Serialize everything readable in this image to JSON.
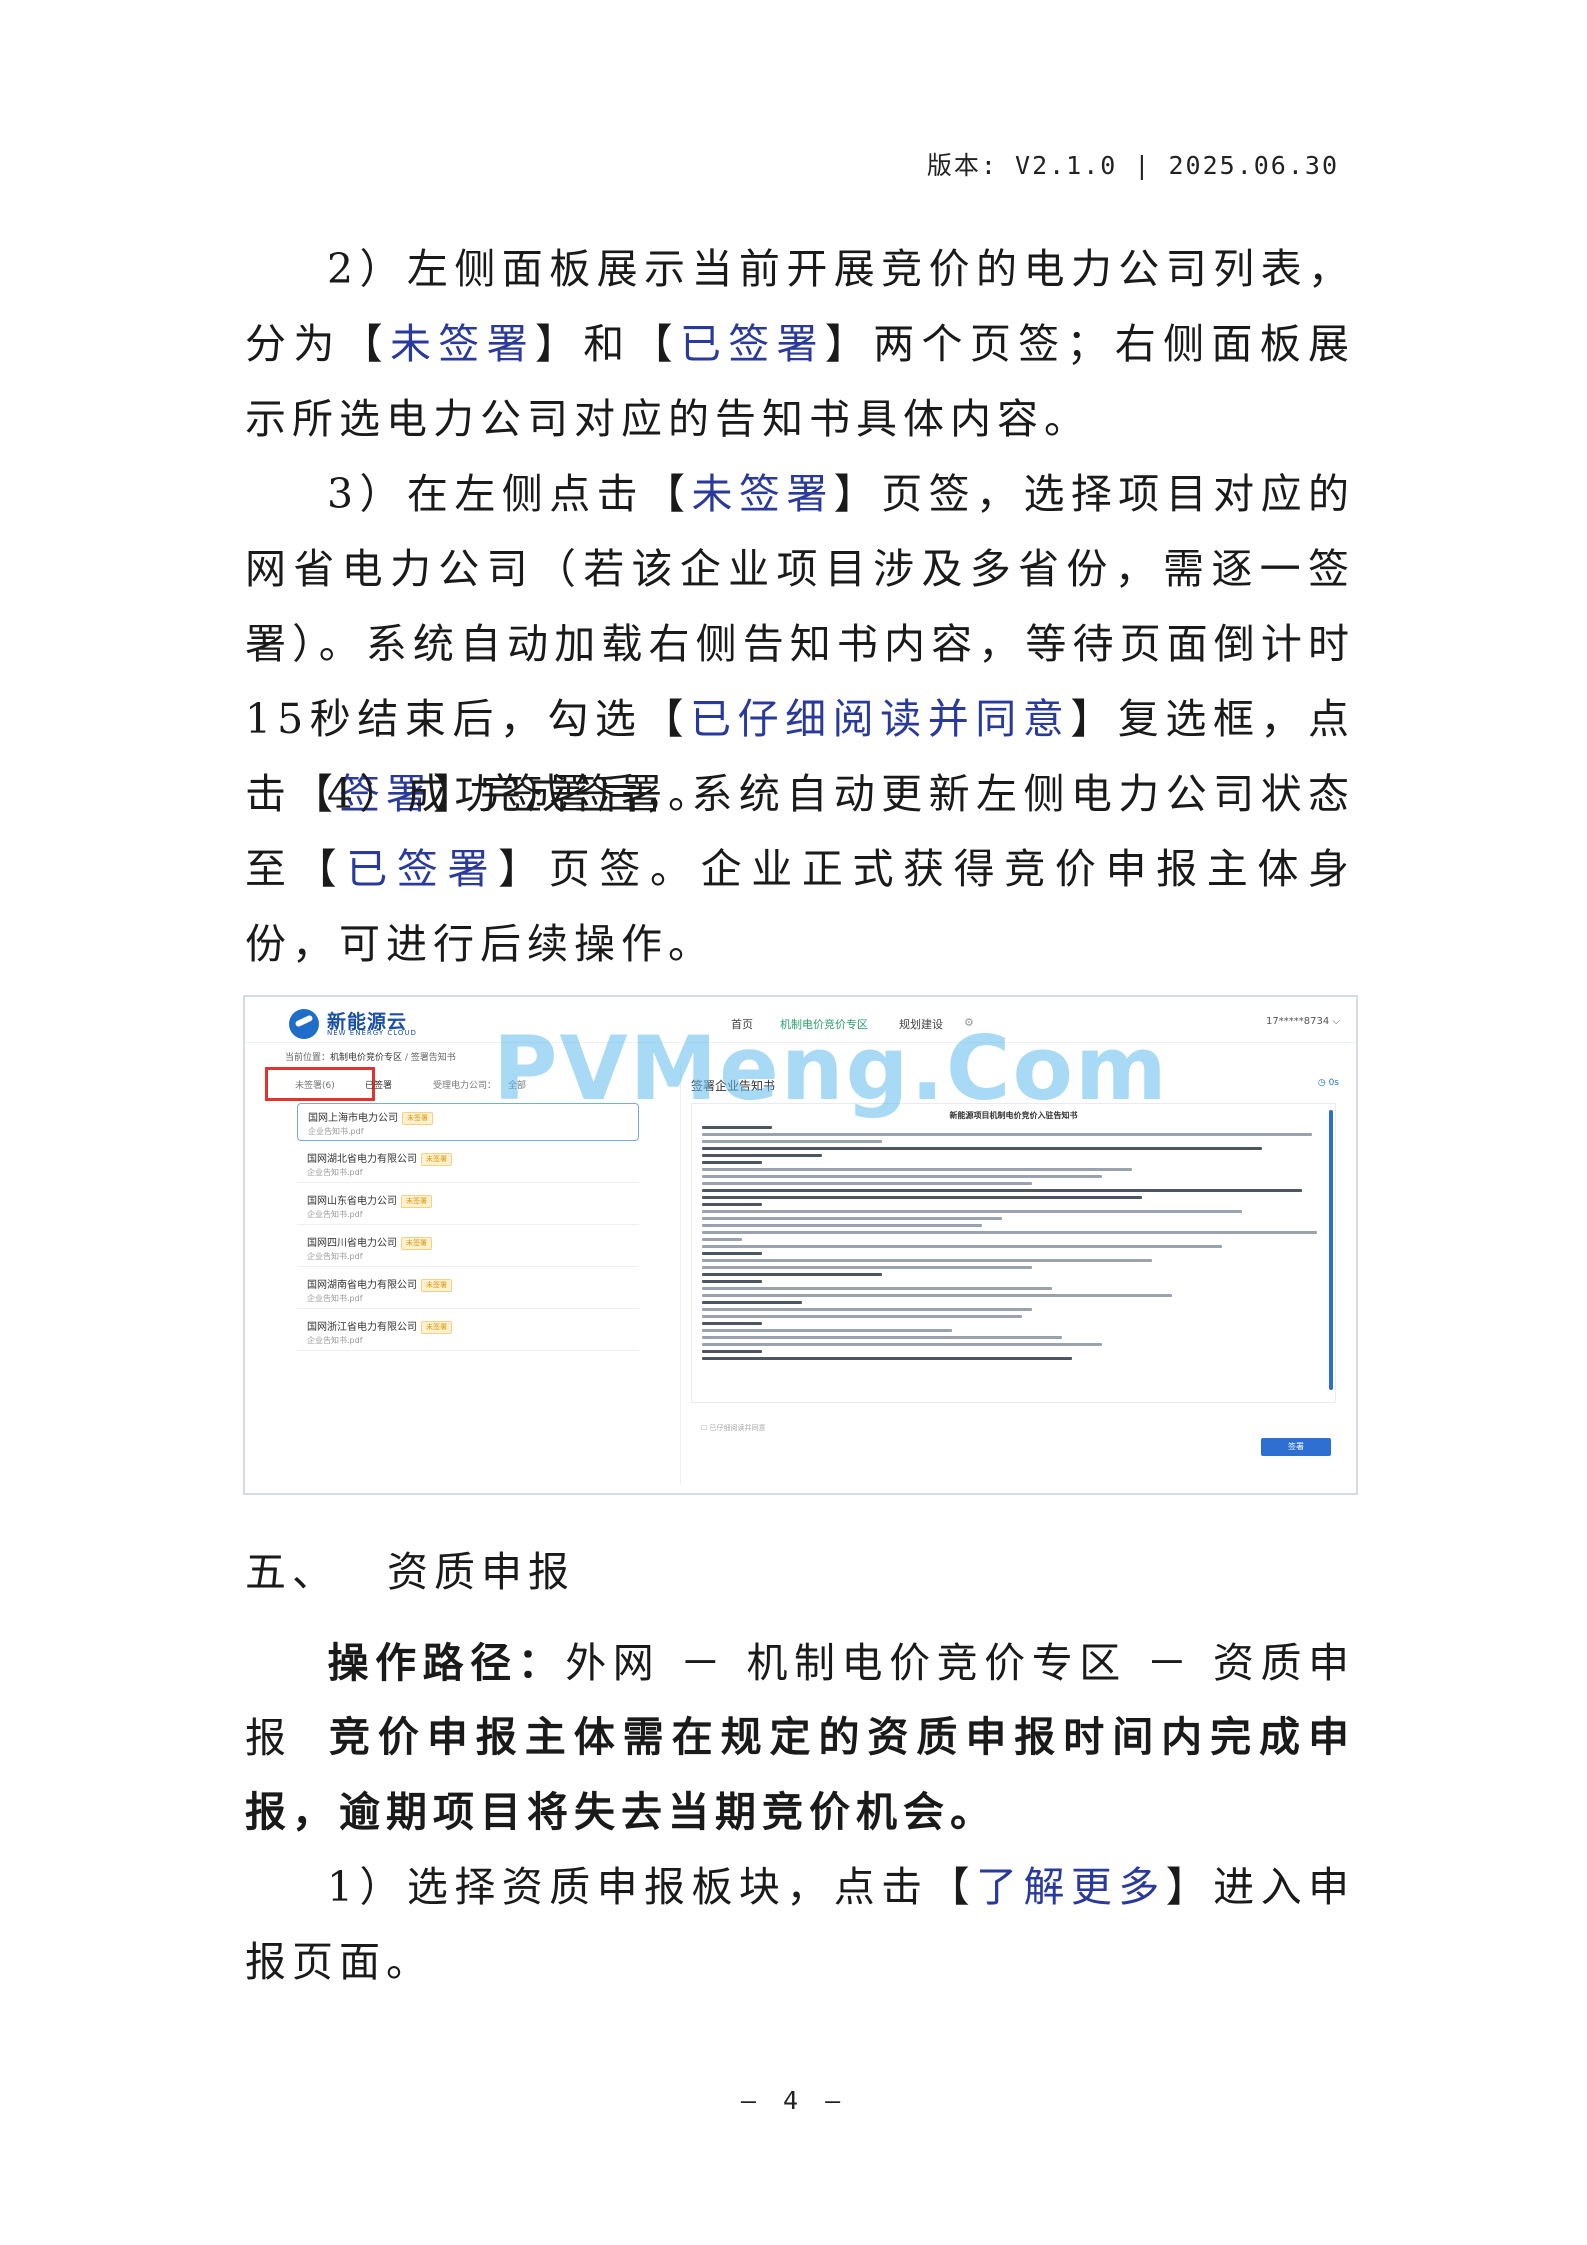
{
  "header": {
    "version": "版本: V2.1.0 | 2025.06.30"
  },
  "para2": {
    "lead": "2）左侧面板展示当前开展竞价的电力公司列表，分为【",
    "tab_unsigned": "未签署",
    "mid": "】和【",
    "tab_signed": "已签署",
    "tail": "】两个页签；右侧面板展示所选电力公司对应的告知书具体内容。"
  },
  "para3": {
    "lead": "3）在左侧点击【",
    "tab_unsigned": "未签署",
    "mid1": "】页签，选择项目对应的网省电力公司（若该企业项目涉及多省份，需逐一签署）。系统自动加载右侧告知书内容，等待页面倒计时15秒结束后，勾选【",
    "checkbox": "已仔细阅读并同意",
    "mid2": "】复选框，点击【",
    "button": "签署",
    "tail": "】完成签署。"
  },
  "para4": {
    "lead": "4）成功签署后，系统自动更新左侧电力公司状态至【",
    "tab_signed": "已签署",
    "tail": "】页签。企业正式获得竞价申报主体身份，可进行后续操作。"
  },
  "screenshot": {
    "logo_title": "新能源云",
    "logo_sub": "NEW ENERGY CLOUD",
    "nav": [
      "首页",
      "机制电价竞价专区",
      "规划建设"
    ],
    "user": "17*****8734",
    "breadcrumb_prefix": "当前位置：",
    "breadcrumb_1": "机制电价竞价专区",
    "breadcrumb_sep": " / ",
    "breadcrumb_2": "签署告知书",
    "tab_unsigned": "未签署(6)",
    "tab_signed": "已签署",
    "filter_label": "受理电力公司：",
    "filter_value": "全部",
    "companies": [
      {
        "name": "国网上海市电力公司",
        "badge": "未签署",
        "file": "企业告知书.pdf"
      },
      {
        "name": "国网湖北省电力有限公司",
        "badge": "未签署",
        "file": "企业告知书.pdf"
      },
      {
        "name": "国网山东省电力公司",
        "badge": "未签署",
        "file": "企业告知书.pdf"
      },
      {
        "name": "国网四川省电力公司",
        "badge": "未签署",
        "file": "企业告知书.pdf"
      },
      {
        "name": "国网湖南省电力有限公司",
        "badge": "未签署",
        "file": "企业告知书.pdf"
      },
      {
        "name": "国网浙江省电力有限公司",
        "badge": "未签署",
        "file": "企业告知书.pdf"
      }
    ],
    "notice_title": "签署企业告知书",
    "countdown": "0s",
    "doc_heading": "新能源项目机制电价竞价入驻告知书",
    "agree_label": "已仔细阅读并同意",
    "sign_button": "签署",
    "watermark": "PVMeng.Com"
  },
  "section5": {
    "number": "五、",
    "title": "资质申报"
  },
  "path": {
    "label": "操作路径：",
    "value": "外网 － 机制电价竞价专区 － 资质申报"
  },
  "intro": "竞价申报主体需在规定的资质申报时间内完成申报，逾期项目将失去当期竞价机会。",
  "step1": {
    "lead": "1）选择资质申报板块，点击【",
    "link": "了解更多",
    "tail": "】进入申报页面。"
  },
  "footer": {
    "page": "— 4 —"
  }
}
